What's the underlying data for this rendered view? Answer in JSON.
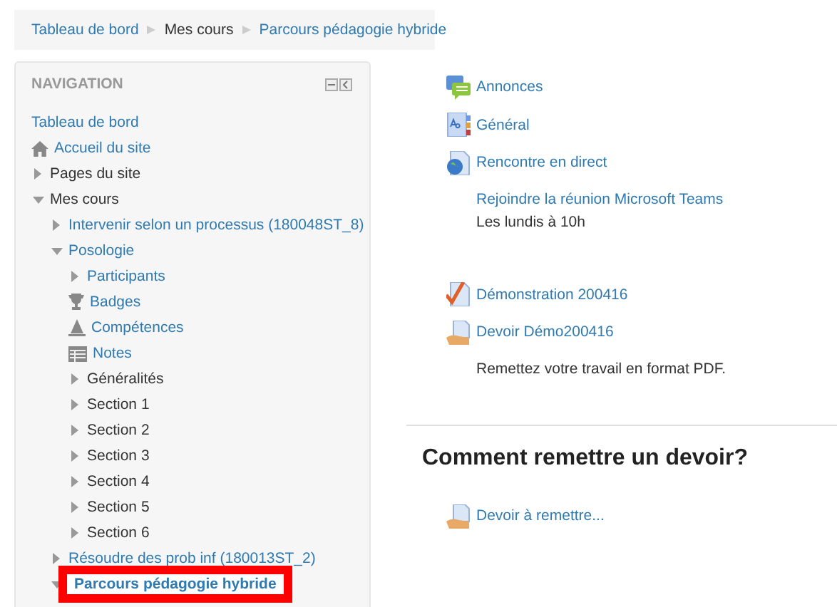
{
  "breadcrumb": [
    {
      "label": "Tableau de bord",
      "link": true
    },
    {
      "label": "Mes cours",
      "link": false
    },
    {
      "label": "Parcours pédagogie hybride",
      "link": true
    }
  ],
  "navigation": {
    "title": "NAVIGATION",
    "items": [
      {
        "label": "Tableau de bord",
        "kind": "plain",
        "link": true,
        "selected": false
      },
      {
        "label": "Accueil du site",
        "kind": "home",
        "link": true,
        "selected": false
      },
      {
        "label": "Pages du site",
        "kind": "branch",
        "expanded": false,
        "link": false,
        "selected": false
      },
      {
        "label": "Mes cours",
        "kind": "branch",
        "expanded": true,
        "link": false,
        "selected": false,
        "children": [
          {
            "label": "Intervenir selon un processus (180048ST_8)",
            "kind": "branch",
            "expanded": false,
            "link": true,
            "selected": false
          },
          {
            "label": "Posologie",
            "kind": "branch",
            "expanded": true,
            "link": true,
            "selected": false,
            "children": [
              {
                "label": "Participants",
                "kind": "branch",
                "expanded": false,
                "link": true,
                "selected": false
              },
              {
                "label": "Badges",
                "kind": "trophy",
                "link": true,
                "selected": false
              },
              {
                "label": "Compétences",
                "kind": "competency",
                "link": true,
                "selected": false
              },
              {
                "label": "Notes",
                "kind": "grid",
                "link": true,
                "selected": false
              },
              {
                "label": "Généralités",
                "kind": "branch",
                "expanded": false,
                "link": false,
                "selected": false
              },
              {
                "label": "Section 1",
                "kind": "branch",
                "expanded": false,
                "link": false,
                "selected": false
              },
              {
                "label": "Section 2",
                "kind": "branch",
                "expanded": false,
                "link": false,
                "selected": false
              },
              {
                "label": "Section 3",
                "kind": "branch",
                "expanded": false,
                "link": false,
                "selected": false
              },
              {
                "label": "Section 4",
                "kind": "branch",
                "expanded": false,
                "link": false,
                "selected": false
              },
              {
                "label": "Section 5",
                "kind": "branch",
                "expanded": false,
                "link": false,
                "selected": false
              },
              {
                "label": "Section 6",
                "kind": "branch",
                "expanded": false,
                "link": false,
                "selected": false
              }
            ]
          },
          {
            "label": "Résoudre des prob inf (180013ST_2)",
            "kind": "branch",
            "expanded": false,
            "link": true,
            "selected": false
          },
          {
            "label": "Parcours pédagogie hybride",
            "kind": "branch",
            "expanded": true,
            "link": true,
            "selected": true
          }
        ]
      }
    ]
  },
  "sections": [
    {
      "activities": [
        {
          "kind": "forum",
          "label": "Annonces"
        },
        {
          "kind": "page",
          "label": "Général"
        },
        {
          "kind": "url",
          "label": "Rencontre en direct",
          "description": [
            {
              "text": "Rejoindre la réunion Microsoft Teams",
              "link": true
            },
            {
              "text": "Les lundis à 10h",
              "link": false
            }
          ]
        },
        {
          "kind": "quiz",
          "label": "Démonstration 200416"
        },
        {
          "kind": "assign",
          "label": "Devoir Démo200416",
          "description": [
            {
              "text": "Remettez votre travail en format PDF.",
              "link": false
            }
          ]
        }
      ]
    },
    {
      "title": "Comment remettre un devoir?",
      "activities": [
        {
          "kind": "assign",
          "label": "Devoir à remettre..."
        }
      ]
    }
  ]
}
